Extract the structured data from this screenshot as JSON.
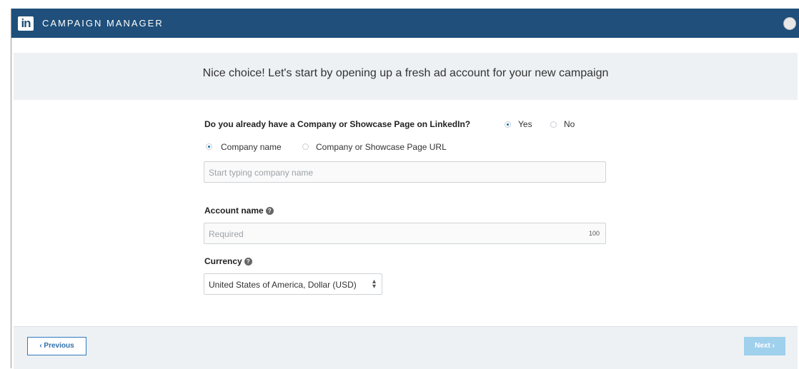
{
  "topbar": {
    "logo_text": "in",
    "app_name": "CAMPAIGN MANAGER"
  },
  "header": {
    "headline": "Nice choice! Let's start by opening up a fresh ad account for your new campaign"
  },
  "company_page": {
    "question": "Do you already have a Company or Showcase Page on LinkedIn?",
    "options": [
      {
        "label": "Yes",
        "selected": true
      },
      {
        "label": "No",
        "selected": false
      }
    ],
    "lookup_options": [
      {
        "label": "Company name",
        "selected": true
      },
      {
        "label": "Company or Showcase Page URL",
        "selected": false
      }
    ],
    "search_placeholder": "Start typing company name"
  },
  "account_name": {
    "label": "Account name",
    "placeholder": "Required",
    "char_limit": "100"
  },
  "currency": {
    "label": "Currency",
    "selected": "United States of America, Dollar (USD)"
  },
  "footer": {
    "previous_label": "‹ Previous",
    "next_label": "Next ›"
  },
  "colors": {
    "topbar": "#1f4f7a",
    "accent": "#0073b1",
    "next_disabled": "#9fd0ec"
  }
}
